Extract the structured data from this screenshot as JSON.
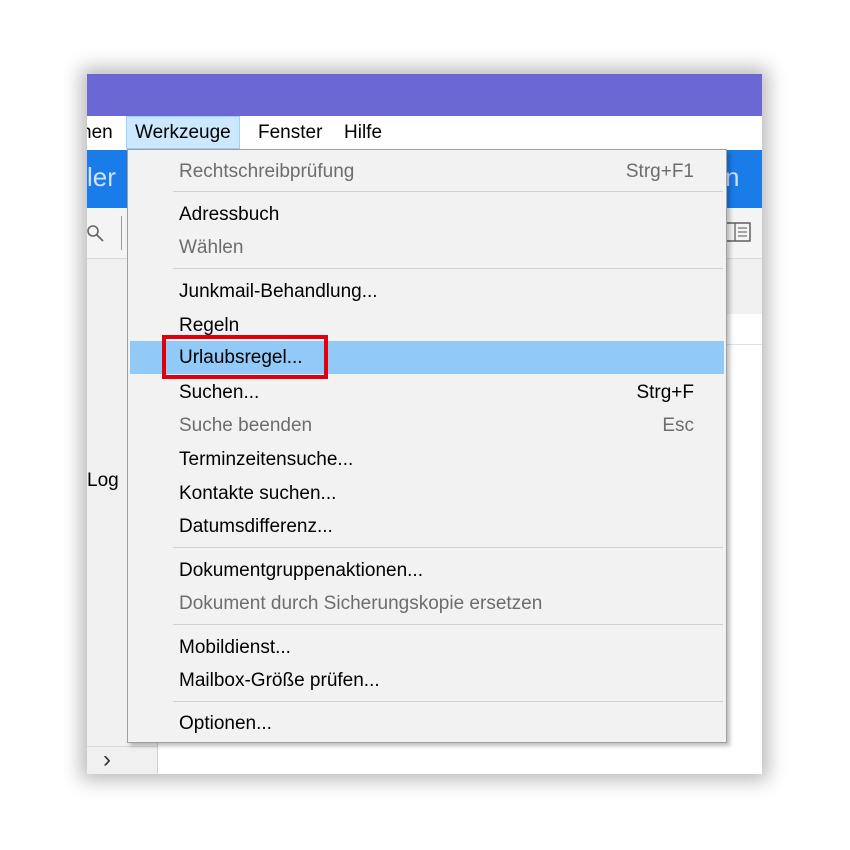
{
  "colors": {
    "titlebar": "#6b67d3",
    "blueband": "#1a7ce8",
    "highlight": "#91c9f7",
    "annotation": "#e0000c"
  },
  "menubar": {
    "items": [
      {
        "label": "hen"
      },
      {
        "label": "Werkzeuge"
      },
      {
        "label": "Fenster"
      },
      {
        "label": "Hilfe"
      }
    ]
  },
  "blueband": {
    "left_text": "ler",
    "right_text": "n"
  },
  "toolbar": {
    "search_icon": "search-icon",
    "view_icon": "view-toggle-icon"
  },
  "left_pane": {
    "label": "Log",
    "scroll_arrow": "›"
  },
  "dropdown": {
    "items": [
      {
        "label": "Rechtschreibprüfung",
        "shortcut": "Strg+F1",
        "disabled": true
      },
      {
        "label": "Adressbuch",
        "shortcut": "",
        "disabled": false
      },
      {
        "label": "Wählen",
        "shortcut": "",
        "disabled": true
      },
      {
        "label": "Junkmail-Behandlung...",
        "shortcut": "",
        "disabled": false
      },
      {
        "label": "Regeln",
        "shortcut": "",
        "disabled": false
      },
      {
        "label": "Urlaubsregel...",
        "shortcut": "",
        "disabled": false,
        "highlighted": true
      },
      {
        "label": "Suchen...",
        "shortcut": "Strg+F",
        "disabled": false
      },
      {
        "label": "Suche beenden",
        "shortcut": "Esc",
        "disabled": true
      },
      {
        "label": "Terminzeitensuche...",
        "shortcut": "",
        "disabled": false
      },
      {
        "label": "Kontakte suchen...",
        "shortcut": "",
        "disabled": false
      },
      {
        "label": "Datumsdifferenz...",
        "shortcut": "",
        "disabled": false
      },
      {
        "label": "Dokumentgruppenaktionen...",
        "shortcut": "",
        "disabled": false
      },
      {
        "label": "Dokument durch Sicherungskopie ersetzen",
        "shortcut": "",
        "disabled": true
      },
      {
        "label": "Mobildienst...",
        "shortcut": "",
        "disabled": false
      },
      {
        "label": "Mailbox-Größe prüfen...",
        "shortcut": "",
        "disabled": false
      },
      {
        "label": "Optionen...",
        "shortcut": "",
        "disabled": false
      }
    ]
  }
}
